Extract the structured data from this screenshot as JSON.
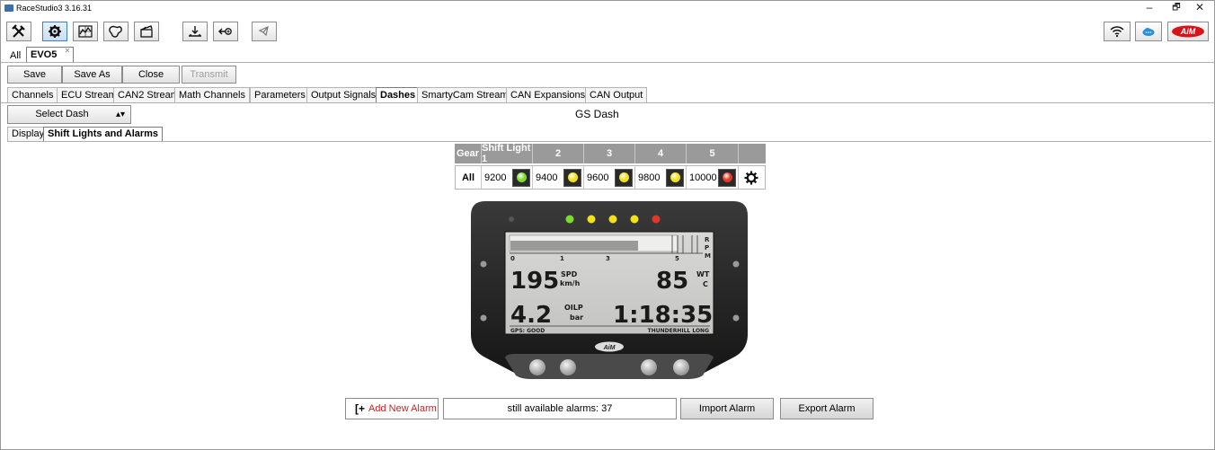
{
  "window": {
    "title": "RaceStudio3 3.16.31",
    "minimize": "–",
    "restore": "🗗",
    "close": "✕"
  },
  "toolbar": {
    "left_icons": [
      "tools-icon",
      "device-config-icon",
      "analysis-icon",
      "track-manager-icon",
      "video-clapper-icon",
      "data-download-icon",
      "import-export-icon",
      "share-icon"
    ],
    "right_icons": [
      "wifi-icon",
      "cloud-icon",
      "aim-logo-icon"
    ],
    "aim_logo": "AiM",
    "active_index": 1
  },
  "doc_tabs": {
    "all": "All",
    "active": "EVO5"
  },
  "actions": {
    "save": "Save",
    "save_as": "Save As",
    "close": "Close",
    "transmit": "Transmit"
  },
  "main_tabs": [
    {
      "label": "Channels"
    },
    {
      "label": "ECU Stream"
    },
    {
      "label": "CAN2 Stream"
    },
    {
      "label": "Math Channels"
    },
    {
      "label": "Parameters"
    },
    {
      "label": "Output Signals"
    },
    {
      "label": "Dashes",
      "active": true
    },
    {
      "label": "SmartyCam Stream"
    },
    {
      "label": "CAN Expansions"
    },
    {
      "label": "CAN Output"
    }
  ],
  "select_dash": {
    "label": "Select Dash",
    "current": "GS Dash"
  },
  "sub_tabs": [
    {
      "label": "Display"
    },
    {
      "label": "Shift Lights and Alarms",
      "active": true
    }
  ],
  "shift_lights": {
    "headers": [
      "Gear",
      "Shift Light 1",
      "2",
      "3",
      "4",
      "5"
    ],
    "gear": "All",
    "lights": [
      {
        "rpm": "9200",
        "color": "#7ddc2a"
      },
      {
        "rpm": "9400",
        "color": "#f2e11a"
      },
      {
        "rpm": "9600",
        "color": "#f2e11a"
      },
      {
        "rpm": "9800",
        "color": "#f2e11a"
      },
      {
        "rpm": "10000",
        "color": "#e2362a"
      }
    ]
  },
  "device_screen": {
    "tick_labels": [
      "0",
      "1",
      "3",
      "5"
    ],
    "rpm_unit": [
      "R",
      "P",
      "M"
    ],
    "speed": {
      "value": "195",
      "name": "SPD",
      "unit": "km/h"
    },
    "water_temp": {
      "value": "85",
      "name": "WT",
      "unit": "C"
    },
    "oil_pressure": {
      "value": "4.2",
      "name": "OILP",
      "unit": "bar"
    },
    "lap_time": "1:18:35",
    "gps_status": "GPS: GOOD",
    "track": "THUNDERHILL LONG",
    "logo": "AiM",
    "leds": [
      "#7ddc2a",
      "#f2e11a",
      "#f2e11a",
      "#f2e11a",
      "#e2362a"
    ]
  },
  "alarms": {
    "add_new": "Add New Alarm",
    "available": "still available alarms: 37",
    "import": "Import Alarm",
    "export": "Export Alarm"
  }
}
